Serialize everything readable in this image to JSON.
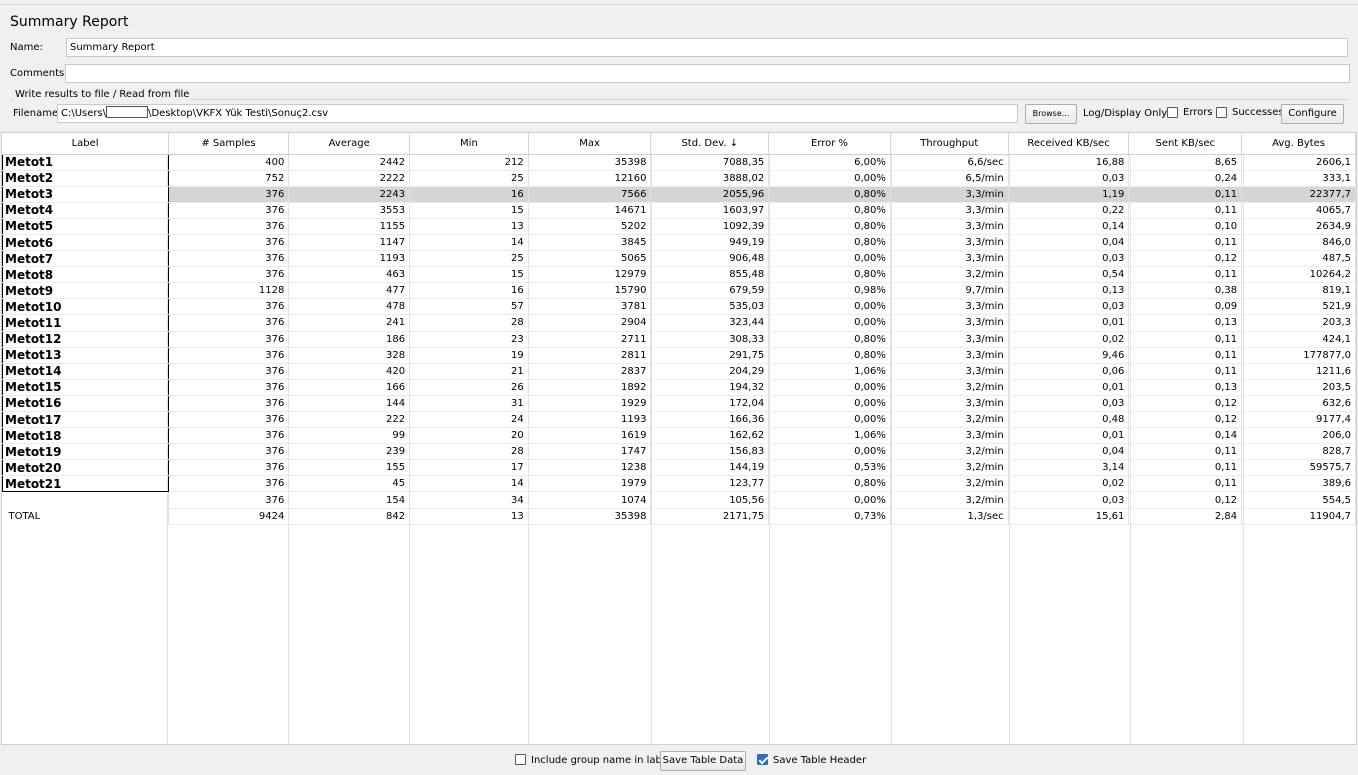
{
  "window": {
    "title": "Summary Report"
  },
  "form": {
    "name_label": "Name:",
    "name_value": "Summary Report",
    "comments_label": "Comments:",
    "comments_value": "",
    "group_title": "Write results to file / Read from file",
    "filename_label": "Filename",
    "filename_prefix": "C:\\Users\\",
    "filename_suffix": "\\Desktop\\VKFX Yük Testi\\Sonuç2.csv",
    "browse_label": "Browse...",
    "log_display_label": "Log/Display Only:",
    "errors_label": "Errors",
    "successes_label": "Successes",
    "configure_label": "Configure"
  },
  "table": {
    "columns": [
      "Label",
      "# Samples",
      "Average",
      "Min",
      "Max",
      "Std. Dev. ↓",
      "Error %",
      "Throughput",
      "Received KB/sec",
      "Sent KB/sec",
      "Avg. Bytes"
    ],
    "rows": [
      [
        "Metot1",
        "400",
        "2442",
        "212",
        "35398",
        "7088,35",
        "6,00%",
        "6,6/sec",
        "16,88",
        "8,65",
        "2606,1"
      ],
      [
        "Metot2",
        "752",
        "2222",
        "25",
        "12160",
        "3888,02",
        "0,00%",
        "6,5/min",
        "0,03",
        "0,24",
        "333,1"
      ],
      [
        "Metot3",
        "376",
        "2243",
        "16",
        "7566",
        "2055,96",
        "0,80%",
        "3,3/min",
        "1,19",
        "0,11",
        "22377,7"
      ],
      [
        "Metot4",
        "376",
        "3553",
        "15",
        "14671",
        "1603,97",
        "0,80%",
        "3,3/min",
        "0,22",
        "0,11",
        "4065,7"
      ],
      [
        "Metot5",
        "376",
        "1155",
        "13",
        "5202",
        "1092,39",
        "0,80%",
        "3,3/min",
        "0,14",
        "0,10",
        "2634,9"
      ],
      [
        "Metot6",
        "376",
        "1147",
        "14",
        "3845",
        "949,19",
        "0,80%",
        "3,3/min",
        "0,04",
        "0,11",
        "846,0"
      ],
      [
        "Metot7",
        "376",
        "1193",
        "25",
        "5065",
        "906,48",
        "0,00%",
        "3,3/min",
        "0,03",
        "0,12",
        "487,5"
      ],
      [
        "Metot8",
        "376",
        "463",
        "15",
        "12979",
        "855,48",
        "0,80%",
        "3,2/min",
        "0,54",
        "0,11",
        "10264,2"
      ],
      [
        "Metot9",
        "1128",
        "477",
        "16",
        "15790",
        "679,59",
        "0,98%",
        "9,7/min",
        "0,13",
        "0,38",
        "819,1"
      ],
      [
        "Metot10",
        "376",
        "478",
        "57",
        "3781",
        "535,03",
        "0,00%",
        "3,3/min",
        "0,03",
        "0,09",
        "521,9"
      ],
      [
        "Metot11",
        "376",
        "241",
        "28",
        "2904",
        "323,44",
        "0,00%",
        "3,3/min",
        "0,01",
        "0,13",
        "203,3"
      ],
      [
        "Metot12",
        "376",
        "186",
        "23",
        "2711",
        "308,33",
        "0,80%",
        "3,3/min",
        "0,02",
        "0,11",
        "424,1"
      ],
      [
        "Metot13",
        "376",
        "328",
        "19",
        "2811",
        "291,75",
        "0,80%",
        "3,3/min",
        "9,46",
        "0,11",
        "177877,0"
      ],
      [
        "Metot14",
        "376",
        "420",
        "21",
        "2837",
        "204,29",
        "1,06%",
        "3,3/min",
        "0,06",
        "0,11",
        "1211,6"
      ],
      [
        "Metot15",
        "376",
        "166",
        "26",
        "1892",
        "194,32",
        "0,00%",
        "3,2/min",
        "0,01",
        "0,13",
        "203,5"
      ],
      [
        "Metot16",
        "376",
        "144",
        "31",
        "1929",
        "172,04",
        "0,00%",
        "3,3/min",
        "0,03",
        "0,12",
        "632,6"
      ],
      [
        "Metot17",
        "376",
        "222",
        "24",
        "1193",
        "166,36",
        "0,00%",
        "3,2/min",
        "0,48",
        "0,12",
        "9177,4"
      ],
      [
        "Metot18",
        "376",
        "99",
        "20",
        "1619",
        "162,62",
        "1,06%",
        "3,3/min",
        "0,01",
        "0,14",
        "206,0"
      ],
      [
        "Metot19",
        "376",
        "239",
        "28",
        "1747",
        "156,83",
        "0,00%",
        "3,2/min",
        "0,04",
        "0,11",
        "828,7"
      ],
      [
        "Metot20",
        "376",
        "155",
        "17",
        "1238",
        "144,19",
        "0,53%",
        "3,2/min",
        "3,14",
        "0,11",
        "59575,7"
      ],
      [
        "Metot21",
        "376",
        "45",
        "14",
        "1979",
        "123,77",
        "0,80%",
        "3,2/min",
        "0,02",
        "0,11",
        "389,6"
      ],
      [
        "",
        "376",
        "154",
        "34",
        "1074",
        "105,56",
        "0,00%",
        "3,2/min",
        "0,03",
        "0,12",
        "554,5"
      ],
      [
        "TOTAL",
        "9424",
        "842",
        "13",
        "35398",
        "2171,75",
        "0,73%",
        "1,3/sec",
        "15,61",
        "2,84",
        "11904,7"
      ]
    ],
    "selected_row": 2
  },
  "footer": {
    "include_group_label": "Include group name in label?",
    "include_group_checked": false,
    "save_table_data_label": "Save Table Data",
    "save_table_header_label": "Save Table Header",
    "save_table_header_checked": true
  },
  "colors": {
    "selection": "#d5d5d5",
    "checkbox_accent": "#2a6fbf"
  }
}
